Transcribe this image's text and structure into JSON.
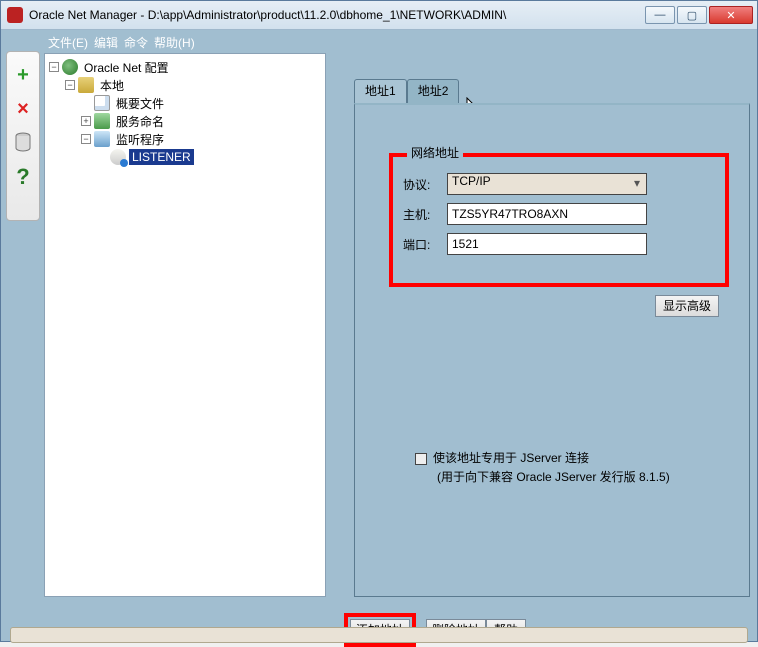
{
  "window": {
    "title": "Oracle Net Manager - D:\\app\\Administrator\\product\\11.2.0\\dbhome_1\\NETWORK\\ADMIN\\"
  },
  "menu": {
    "file": "文件(E)",
    "edit": "编辑",
    "command": "命令",
    "help": "帮助(H)"
  },
  "sidebar": {
    "add": "+",
    "remove": "×",
    "help": "?"
  },
  "tree": {
    "root": "Oracle Net 配置",
    "local": "本地",
    "profile": "概要文件",
    "service": "服务命名",
    "listener": "监听程序",
    "listener_child": "LISTENER"
  },
  "tabs": {
    "addr1": "地址1",
    "addr2": "地址2"
  },
  "net": {
    "legend": "网络地址",
    "protocol_label": "协议:",
    "protocol_value": "TCP/IP",
    "host_label": "主机:",
    "host_value": "TZS5YR47TRO8AXN",
    "port_label": "端口:",
    "port_value": "1521"
  },
  "adv_button": "显示高级",
  "jserver": {
    "checkbox_label": "使该地址专用于 JServer 连接",
    "note": "(用于向下兼容 Oracle JServer 发行版 8.1.5)"
  },
  "bottom": {
    "add": "添加地址",
    "delete": "删除地址",
    "help": "帮助"
  }
}
